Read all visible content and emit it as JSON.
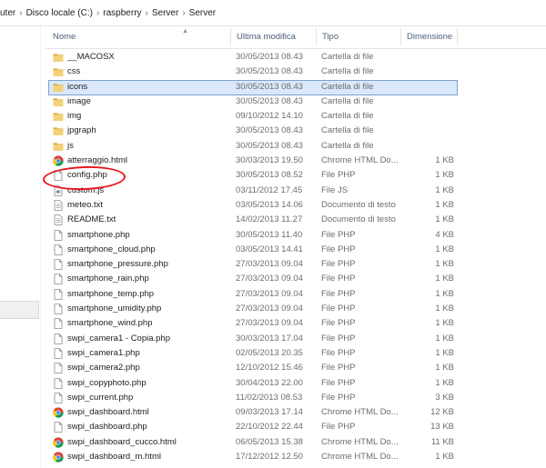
{
  "breadcrumb": [
    "uter",
    "Disco locale (C:)",
    "raspberry",
    "Server",
    "Server"
  ],
  "columns": {
    "name": "Nome",
    "modified": "Ultima modifica",
    "type": "Tipo",
    "size": "Dimensione"
  },
  "files": [
    {
      "name": "__MACOSX",
      "date": "30/05/2013 08.43",
      "type": "Cartella di file",
      "size": "",
      "icon": "folder-icon"
    },
    {
      "name": "css",
      "date": "30/05/2013 08.43",
      "type": "Cartella di file",
      "size": "",
      "icon": "folder-icon"
    },
    {
      "name": "icons",
      "date": "30/05/2013 08.43",
      "type": "Cartella di file",
      "size": "",
      "icon": "folder-icon",
      "selected": true
    },
    {
      "name": "image",
      "date": "30/05/2013 08.43",
      "type": "Cartella di file",
      "size": "",
      "icon": "folder-icon"
    },
    {
      "name": "img",
      "date": "09/10/2012 14.10",
      "type": "Cartella di file",
      "size": "",
      "icon": "folder-icon"
    },
    {
      "name": "jpgraph",
      "date": "30/05/2013 08.43",
      "type": "Cartella di file",
      "size": "",
      "icon": "folder-icon"
    },
    {
      "name": "js",
      "date": "30/05/2013 08.43",
      "type": "Cartella di file",
      "size": "",
      "icon": "folder-icon"
    },
    {
      "name": "atterraggio.html",
      "date": "30/03/2013 19.50",
      "type": "Chrome HTML Do...",
      "size": "1 KB",
      "icon": "chrome-icon"
    },
    {
      "name": "config.php",
      "date": "30/05/2013 08.52",
      "type": "File PHP",
      "size": "1 KB",
      "icon": "file-icon",
      "annotated": true
    },
    {
      "name": "custom.js",
      "date": "03/11/2012 17.45",
      "type": "File JS",
      "size": "1 KB",
      "icon": "script-icon"
    },
    {
      "name": "meteo.txt",
      "date": "03/05/2013 14.06",
      "type": "Documento di testo",
      "size": "1 KB",
      "icon": "text-file-icon"
    },
    {
      "name": "README.txt",
      "date": "14/02/2013 11.27",
      "type": "Documento di testo",
      "size": "1 KB",
      "icon": "text-file-icon"
    },
    {
      "name": "smartphone.php",
      "date": "30/05/2013 11.40",
      "type": "File PHP",
      "size": "4 KB",
      "icon": "file-icon"
    },
    {
      "name": "smartphone_cloud.php",
      "date": "03/05/2013 14.41",
      "type": "File PHP",
      "size": "1 KB",
      "icon": "file-icon"
    },
    {
      "name": "smartphone_pressure.php",
      "date": "27/03/2013 09.04",
      "type": "File PHP",
      "size": "1 KB",
      "icon": "file-icon"
    },
    {
      "name": "smartphone_rain.php",
      "date": "27/03/2013 09.04",
      "type": "File PHP",
      "size": "1 KB",
      "icon": "file-icon"
    },
    {
      "name": "smartphone_temp.php",
      "date": "27/03/2013 09.04",
      "type": "File PHP",
      "size": "1 KB",
      "icon": "file-icon"
    },
    {
      "name": "smartphone_umidity.php",
      "date": "27/03/2013 09.04",
      "type": "File PHP",
      "size": "1 KB",
      "icon": "file-icon"
    },
    {
      "name": "smartphone_wind.php",
      "date": "27/03/2013 09.04",
      "type": "File PHP",
      "size": "1 KB",
      "icon": "file-icon"
    },
    {
      "name": "swpi_camera1 - Copia.php",
      "date": "30/03/2013 17.04",
      "type": "File PHP",
      "size": "1 KB",
      "icon": "file-icon"
    },
    {
      "name": "swpi_camera1.php",
      "date": "02/05/2013 20.35",
      "type": "File PHP",
      "size": "1 KB",
      "icon": "file-icon"
    },
    {
      "name": "swpi_camera2.php",
      "date": "12/10/2012 15.46",
      "type": "File PHP",
      "size": "1 KB",
      "icon": "file-icon"
    },
    {
      "name": "swpi_copyphoto.php",
      "date": "30/04/2013 22.00",
      "type": "File PHP",
      "size": "1 KB",
      "icon": "file-icon"
    },
    {
      "name": "swpi_current.php",
      "date": "11/02/2013 08.53",
      "type": "File PHP",
      "size": "3 KB",
      "icon": "file-icon"
    },
    {
      "name": "swpi_dashboard.html",
      "date": "09/03/2013 17.14",
      "type": "Chrome HTML Do...",
      "size": "12 KB",
      "icon": "chrome-icon"
    },
    {
      "name": "swpi_dashboard.php",
      "date": "22/10/2012 22.44",
      "type": "File PHP",
      "size": "13 KB",
      "icon": "file-icon"
    },
    {
      "name": "swpi_dashboard_cucco.html",
      "date": "06/05/2013 15.38",
      "type": "Chrome HTML Do...",
      "size": "11 KB",
      "icon": "chrome-icon"
    },
    {
      "name": "swpi_dashboard_m.html",
      "date": "17/12/2012 12.50",
      "type": "Chrome HTML Do...",
      "size": "1 KB",
      "icon": "chrome-icon"
    }
  ],
  "colors": {
    "selection_bg": "#d9e8fa",
    "selection_border": "#7da2ce",
    "header_text": "#4c607a",
    "annotation": "#e8181e",
    "folder": "#e8c060"
  }
}
